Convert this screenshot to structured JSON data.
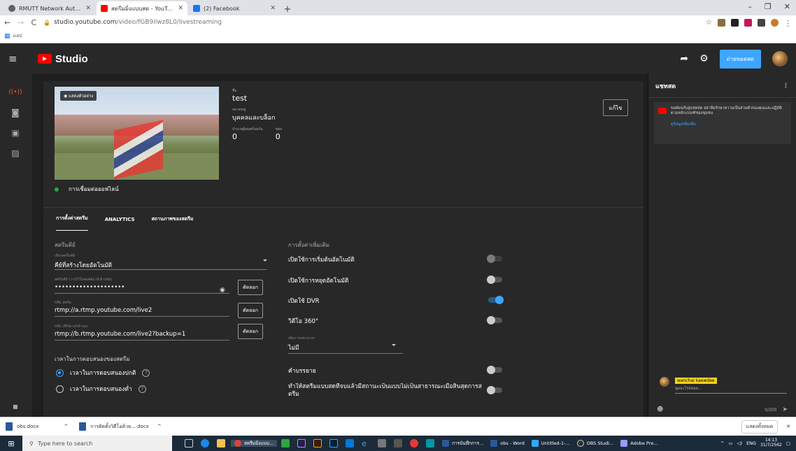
{
  "browser": {
    "tabs": [
      {
        "title": "RMUTT Network Authentication",
        "color": "#5f6368"
      },
      {
        "title": "สตรีมมิ่งแบบสด - YouTube Studio",
        "color": "#ff0000"
      },
      {
        "title": "(2) Facebook",
        "color": "#1877f2"
      }
    ],
    "new_tab": "+",
    "url_host": "studio.youtube.com",
    "url_path": "/video/fGB9ilwz8L0/livestreaming",
    "bookmarks_label": "แอป"
  },
  "studio": {
    "brand": "Studio",
    "golive_label": "ถ่ายทอดสด"
  },
  "stream": {
    "preview_badge": "แสดงตัวอย่าง",
    "title_label": "ชื่อ",
    "title": "test",
    "category_label": "หมวดหมู่",
    "category": "บุคคลและบล็อก",
    "viewers_label": "จำนวนผู้ชมพร้อมกัน",
    "viewers": "0",
    "likes_label": "ชอบ",
    "likes": "0",
    "edit_label": "แก้ไข",
    "connection": "การเชื่อมต่อออฟไลน์"
  },
  "tabs": [
    "การตั้งค่าสตรีม",
    "ANALYTICS",
    "สถานภาพของสตรีม"
  ],
  "settings": {
    "stream_key_section": "สตรีมคีย์",
    "key_select_label": "เลือกสตรีมคีย์",
    "key_select_value": "คีย์ที่สร้างโดยอัตโนมัติ",
    "key_label": "สตรีมคีย์ (วางไว้ในซอฟต์แวร์เข้ารหัส)",
    "key_value": "••••••••••••••••••••",
    "url_label": "URL สตรีม",
    "url_value": "rtmp://a.rtmp.youtube.com/live2",
    "backup_label": "URL เซิร์ฟเวอร์สำรอง",
    "backup_value": "rtmp://b.rtmp.youtube.com/live2?backup=1",
    "copy_label": "คัดลอก",
    "latency_section": "เวลาในการตอบสนองของสตรีม",
    "latency_normal": "เวลาในการตอบสนองปกติ",
    "latency_low": "เวลาในการตอบสนองต่ำ",
    "additional_section": "การตั้งค่าเพิ่มเติม",
    "auto_start": "เปิดใช้การเริ่มต้นอัตโนมัติ",
    "auto_stop": "เปิดใช้การหยุดอัตโนมัติ",
    "dvr": "เปิดใช้ DVR",
    "video360": "วิดีโอ 360°",
    "delay_label": "เพิ่มการหน่วงเวลา",
    "delay_value": "ไม่มี",
    "captions": "คำบรรยาย",
    "unlist": "ทำให้สตรีมแบบสดที่จบแล้วมีสถานะเป็นแบบไม่เป็นสาธารณะเมื่อสิ้นสุดการสตรีม"
  },
  "chat": {
    "header": "แชทสด",
    "system_message": "ขอต้อนรับสู่แชทสด อย่าลืมรักษาความเป็นส่วนตัวของคุณและปฏิบัติตามหลักเกณฑ์ของชุมชน",
    "learn_more": "ดูข้อมูลเพิ่มเติม",
    "username": "wanchai kaewdee",
    "input_placeholder": "พูดอะไรหน่อย...",
    "counter": "0/200"
  },
  "downloads": {
    "items": [
      "obs.docx",
      "การติดตั้งวิดีโอด้วย....docx"
    ],
    "show_all": "แสดงทั้งหมด"
  },
  "taskbar": {
    "search_placeholder": "Type here to search",
    "apps": [
      "สตรีมมิ่งแบบ...",
      "การบันทึกการ...",
      "obs - Word",
      "Untitled-1-...",
      "OBS Studi...",
      "Adobe Pre..."
    ],
    "lang": "ENG",
    "time": "14:13",
    "date": "31/7/2562"
  }
}
